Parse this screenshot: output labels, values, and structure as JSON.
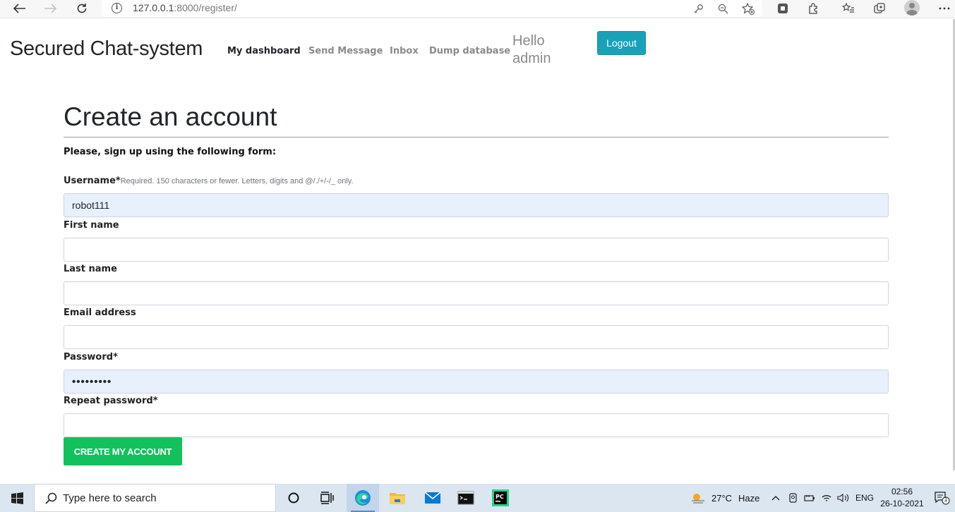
{
  "browser": {
    "url_host": "127.0.0.1",
    "url_rest": ":8000/register/"
  },
  "navbar": {
    "brand": "Secured Chat-system",
    "links": [
      "My dashboard",
      "Send Message",
      "Inbox",
      "Dump database"
    ],
    "greeting": "Hello admin",
    "logout_label": "Logout"
  },
  "form": {
    "heading": "Create an account",
    "intro": "Please, sign up using the following form:",
    "username_label": "Username*",
    "username_help": "Required. 150 characters or fewer. Letters, digits and @/./+/-/_ only.",
    "username_value": "robot111",
    "first_name_label": "First name",
    "first_name_value": "",
    "last_name_label": "Last name",
    "last_name_value": "",
    "email_label": "Email address",
    "email_value": "",
    "password_label": "Password*",
    "password_value": "•••••••••",
    "repeat_password_label": "Repeat password*",
    "repeat_password_value": "",
    "submit_label": "CREATE MY ACCOUNT"
  },
  "taskbar": {
    "search_placeholder": "Type here to search",
    "weather_temp": "27°C",
    "weather_desc": "Haze",
    "language": "ENG",
    "time": "02:56",
    "date": "26-10-2021",
    "notification_count": "1"
  },
  "colors": {
    "logout": "#17a2b8",
    "submit": "#13c15c",
    "autofill": "#e8f0fe"
  }
}
